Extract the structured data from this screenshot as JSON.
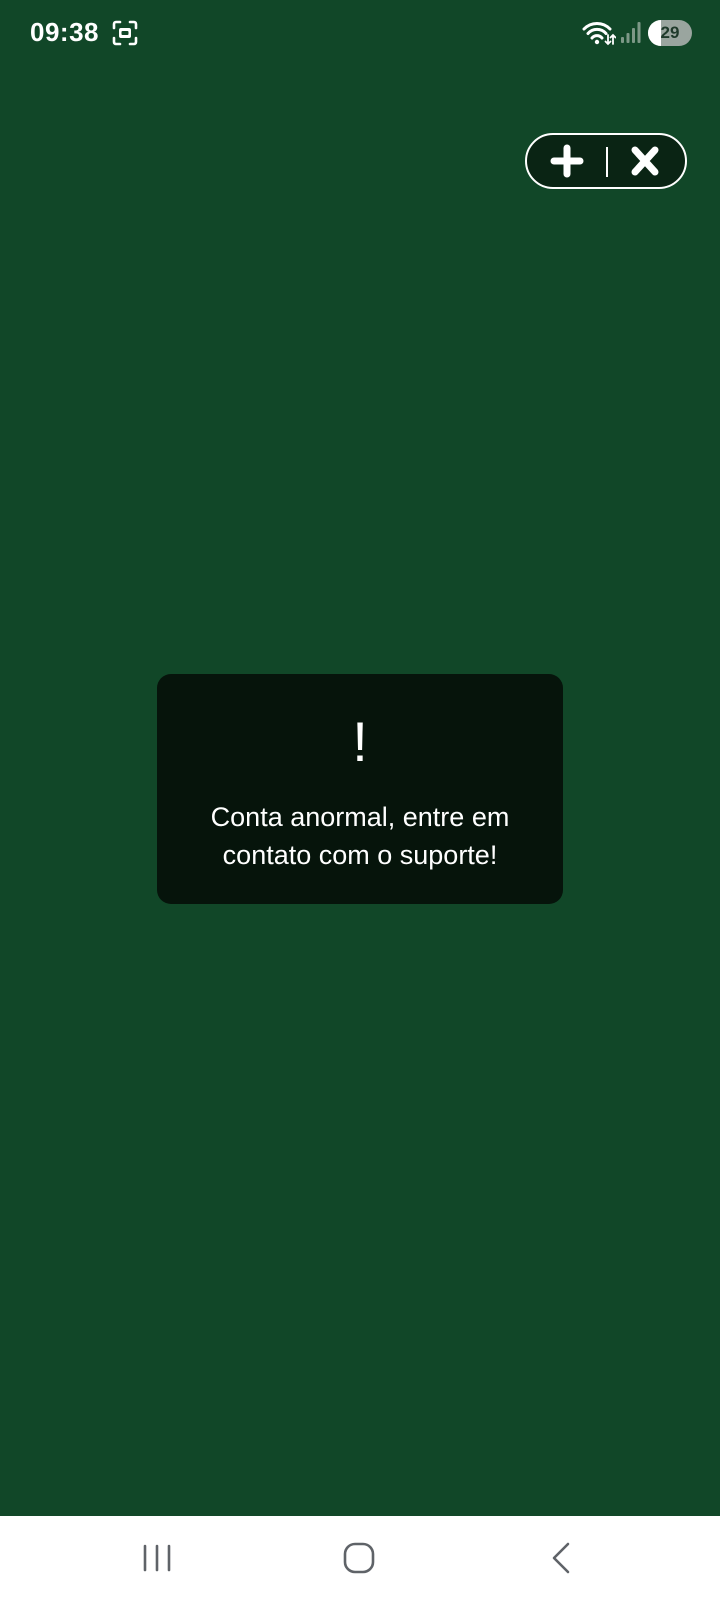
{
  "status_bar": {
    "time": "09:38",
    "battery_level": "29",
    "icons": [
      "screenshot-icon",
      "wifi-icon",
      "signal-icon",
      "battery-icon"
    ]
  },
  "mini_program_capsule": {
    "buttons": [
      "plus-icon",
      "close-icon"
    ]
  },
  "toast": {
    "mark": "!",
    "message": "Conta anormal, entre em contato com o suporte!"
  },
  "navigation_bar": {
    "buttons": [
      "recent-apps-icon",
      "home-icon",
      "back-icon"
    ]
  },
  "colors": {
    "background": "#114728",
    "toast_background": "#06140b",
    "capsule_background": "#0a2414",
    "navbar_background": "#ffffff",
    "text": "#ffffff"
  }
}
